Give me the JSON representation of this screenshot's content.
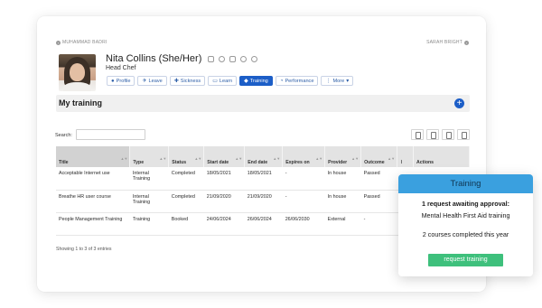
{
  "nav": {
    "prev": "MUHAMMAD BADRI",
    "next": "SARAH BRIGHT"
  },
  "profile": {
    "name": "Nita Collins (She/Her)",
    "job_title": "Head Chef"
  },
  "tabs": [
    {
      "label": "Profile",
      "icon": "user-icon"
    },
    {
      "label": "Leave",
      "icon": "plane-icon"
    },
    {
      "label": "Sickness",
      "icon": "medical-icon"
    },
    {
      "label": "Learn",
      "icon": "monitor-icon"
    },
    {
      "label": "Training",
      "icon": "graduation-cap-icon",
      "active": true
    },
    {
      "label": "Performance",
      "icon": "gauge-icon"
    },
    {
      "label": "More",
      "icon": "more-icon"
    }
  ],
  "section": {
    "title": "My training"
  },
  "search": {
    "label": "Search:",
    "value": ""
  },
  "table": {
    "headers": [
      "Title",
      "Type",
      "Status",
      "Start date",
      "End date",
      "Expires on",
      "Provider",
      "Outcome",
      "",
      "Actions"
    ],
    "rows": [
      [
        "Acceptable Internet use",
        "Internal Training",
        "Completed",
        "18/05/2021",
        "18/05/2021",
        "-",
        "In house",
        "Passed",
        "",
        ""
      ],
      [
        "Breathe HR user course",
        "Internal Training",
        "Completed",
        "21/09/2020",
        "21/09/2020",
        "-",
        "In house",
        "Passed",
        "",
        ""
      ],
      [
        "People Management Training",
        "Training",
        "Booked",
        "24/06/2024",
        "26/06/2024",
        "26/06/2030",
        "External",
        "-",
        "",
        ""
      ]
    ]
  },
  "footer": {
    "info": "Showing 1 to 3 of 3 entries"
  },
  "popup": {
    "title": "Training",
    "line1": "1 request awaiting approval:",
    "line2": "Mental Health First Aid training",
    "line3": "2 courses completed this year",
    "button": "request training"
  },
  "colors": {
    "accent": "#1c5ec7",
    "popup_header": "#3aa0df",
    "popup_button": "#3ec07c"
  }
}
